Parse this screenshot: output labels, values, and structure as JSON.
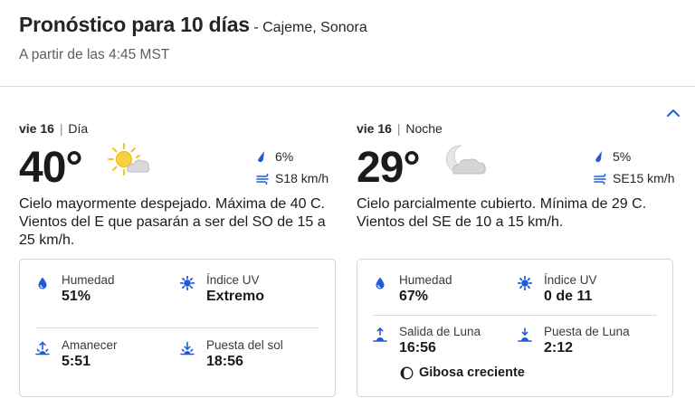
{
  "header": {
    "title": "Pronóstico para 10 días",
    "location": "- Cajeme, Sonora",
    "subtitle": "A partir de las 4:45 MST"
  },
  "colors": {
    "accent": "#1f5bd9",
    "sun": "#f5c21b",
    "cloud": "#c8c8c8"
  },
  "day": {
    "date": "vie 16",
    "period": "Día",
    "temp": "40°",
    "icon": "sun-cloud-icon",
    "precip": "6%",
    "wind": "S18 km/h",
    "description": "Cielo mayormente despejado. Máxima de 40 C. Vientos del E que pasarán a ser del SO de 15 a 25 km/h.",
    "details": {
      "humidity_label": "Humedad",
      "humidity": "51%",
      "uv_label": "Índice UV",
      "uv": "Extremo",
      "sunrise_label": "Amanecer",
      "sunrise": "5:51",
      "sunset_label": "Puesta del sol",
      "sunset": "18:56"
    }
  },
  "night": {
    "date": "vie 16",
    "period": "Noche",
    "temp": "29°",
    "icon": "moon-cloud-icon",
    "precip": "5%",
    "wind": "SE15 km/h",
    "description": "Cielo parcialmente cubierto. Mínima de 29 C. Vientos del SE de 10 a 15 km/h.",
    "details": {
      "humidity_label": "Humedad",
      "humidity": "67%",
      "uv_label": "Índice UV",
      "uv": "0 de 11",
      "moonrise_label": "Salida de Luna",
      "moonrise": "16:56",
      "moonset_label": "Puesta de Luna",
      "moonset": "2:12",
      "moon_phase": "Gibosa creciente"
    }
  }
}
